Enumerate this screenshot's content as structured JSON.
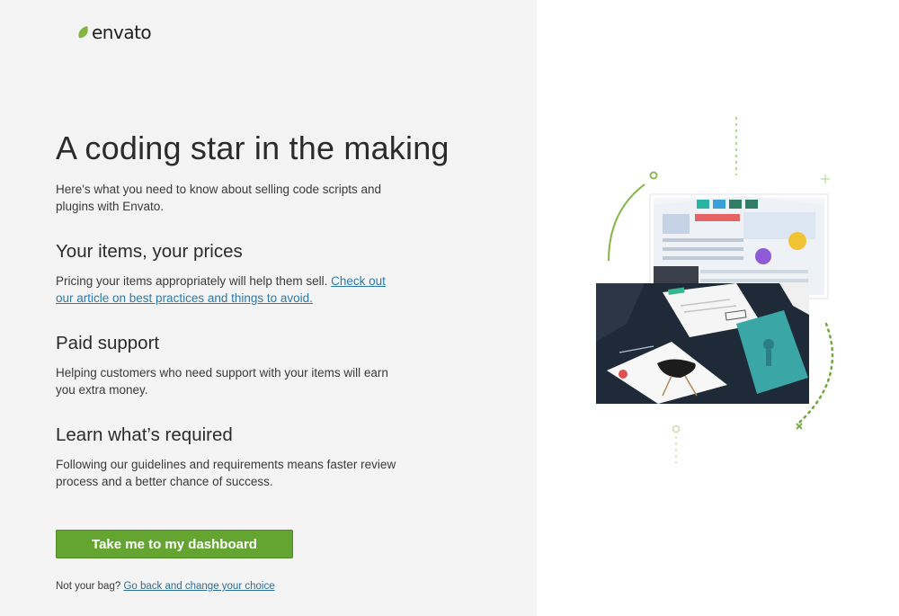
{
  "brand": {
    "name": "envato",
    "leaf_color": "#82b541"
  },
  "heading": "A coding star in the making",
  "intro": "Here's what you need to know about selling code scripts and plugins with Envato.",
  "sections": [
    {
      "title": "Your items, your prices",
      "body": "Pricing your items appropriately will help them sell.",
      "link": "Check out our article on best practices and things to avoid."
    },
    {
      "title": "Paid support",
      "body": "Helping customers who need support with your items will earn you extra money."
    },
    {
      "title": "Learn what’s required",
      "body": "Following our guidelines and requirements means faster review process and a better chance of success."
    }
  ],
  "cta": {
    "label": "Take me to my dashboard",
    "color": "#64a532"
  },
  "footer": {
    "prompt": "Not your bag?",
    "link": "Go back and change your choice"
  },
  "illustration": {
    "icon": "marketplace-screens-illustration"
  }
}
